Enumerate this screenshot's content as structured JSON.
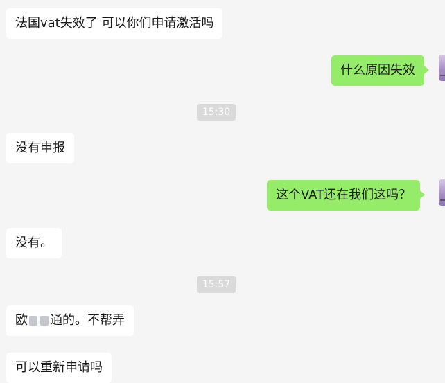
{
  "chat": {
    "messages": [
      {
        "sender": "contact",
        "text": "法国vat失效了 可以你们申请激活吗"
      },
      {
        "sender": "self",
        "text": "什么原因失效"
      },
      {
        "sender": "contact",
        "text": "没有申报"
      },
      {
        "sender": "self",
        "text": "这个VAT还在我们这吗？"
      },
      {
        "sender": "contact",
        "text": "没有。"
      },
      {
        "sender": "contact",
        "text_start": "欧",
        "text_end": "通的。不帮弄"
      },
      {
        "sender": "contact",
        "text": "可以重新申请吗"
      }
    ],
    "timestamps": [
      "15:30",
      "15:57"
    ]
  },
  "colors": {
    "background": "#f5f5f5",
    "incoming_bubble": "#ffffff",
    "outgoing_bubble": "#95ec69",
    "timestamp_badge": "#dadada"
  },
  "icons": {
    "avatar": "user-avatar-icon"
  }
}
